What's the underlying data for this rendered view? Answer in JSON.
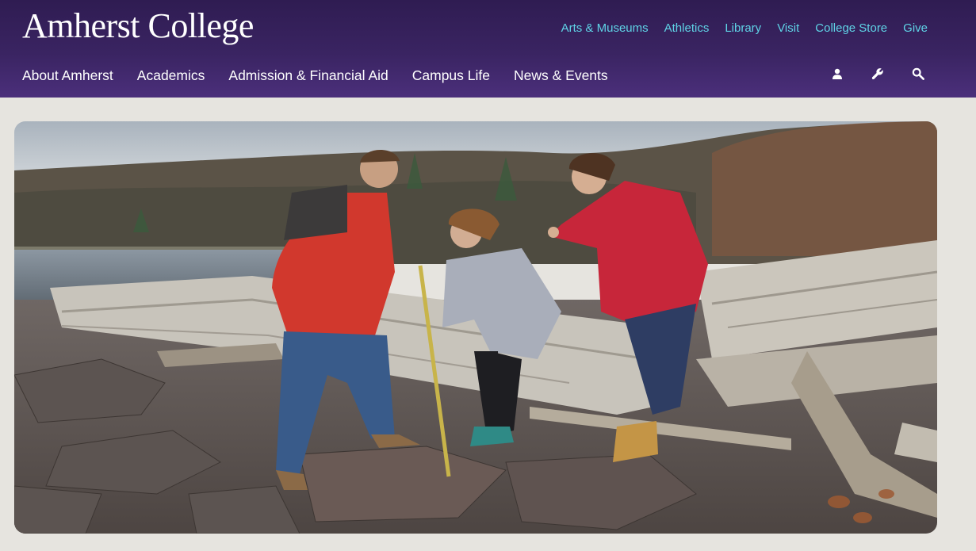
{
  "header": {
    "brand": "Amherst College",
    "utility_links": [
      {
        "label": "Arts & Museums"
      },
      {
        "label": "Athletics"
      },
      {
        "label": "Library"
      },
      {
        "label": "Visit"
      },
      {
        "label": "College Store"
      },
      {
        "label": "Give"
      }
    ],
    "main_nav": [
      {
        "label": "About Amherst"
      },
      {
        "label": "Academics"
      },
      {
        "label": "Admission & Financial Aid"
      },
      {
        "label": "Campus Life"
      },
      {
        "label": "News & Events"
      }
    ],
    "tools": [
      {
        "icon": "user-icon"
      },
      {
        "icon": "wrench-icon"
      },
      {
        "icon": "search-icon"
      }
    ]
  },
  "hero": {
    "scene": "three people on driftwood shore pointing, holding measuring rod"
  },
  "colors": {
    "header_top": "#2f1c52",
    "header_bottom": "#4b2f7b",
    "utility_link": "#5fd3e6",
    "page_bg": "#e6e4df"
  }
}
